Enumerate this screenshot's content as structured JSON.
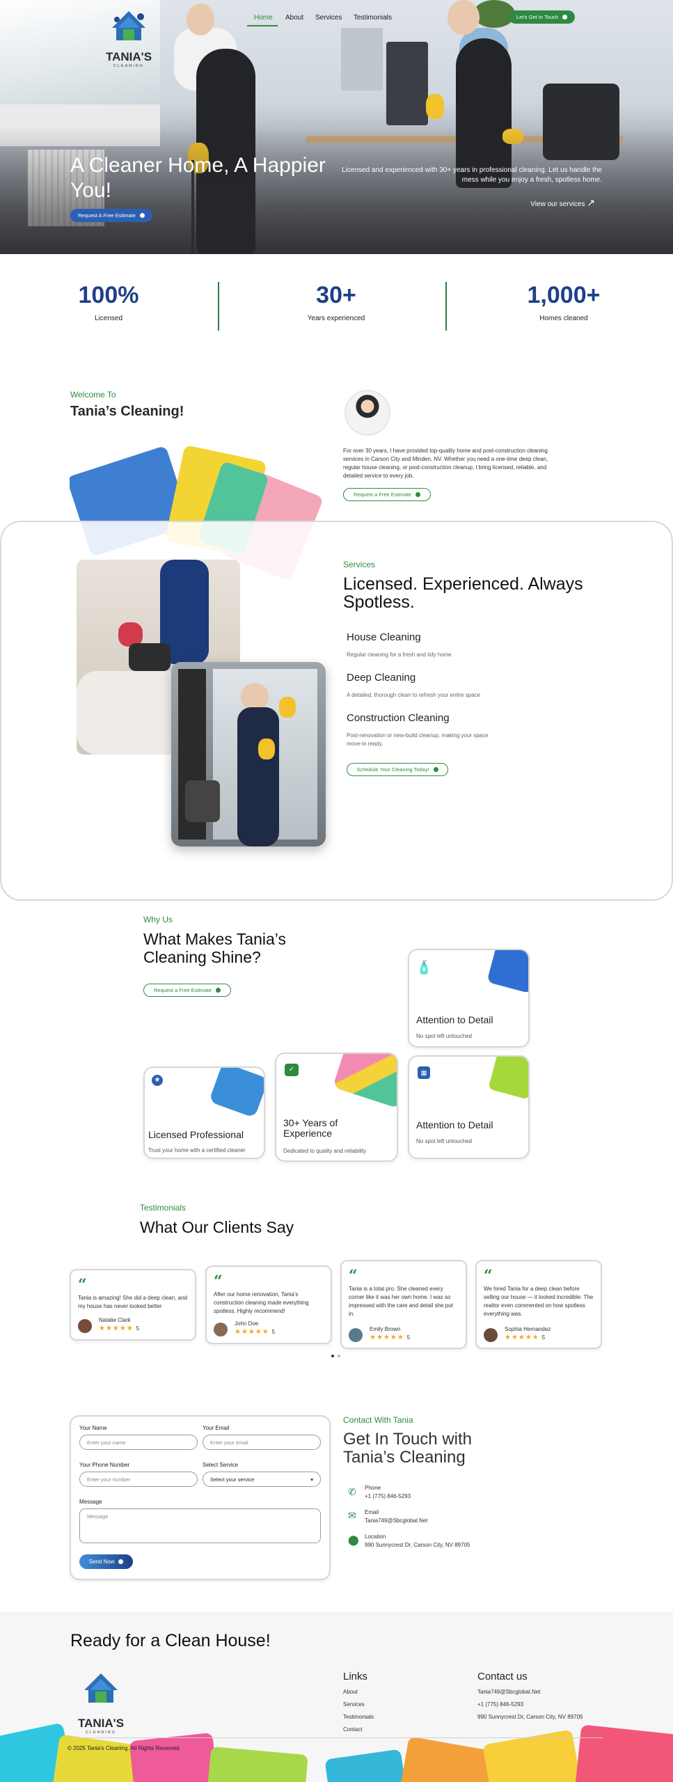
{
  "brand": {
    "name": "TANIA'S",
    "sub": "CLEANING"
  },
  "nav": {
    "items": [
      "Home",
      "About",
      "Services",
      "Testimonials"
    ],
    "cta": "Let's Get In Touch"
  },
  "hero": {
    "title": "A Cleaner Home, A Happier You!",
    "cta": "Request A Free Estimate",
    "blurb": "Licensed and experienced with 30+ years in professional cleaning. Let us handle the mess while you enjoy a fresh, spotless home.",
    "link": "View our services"
  },
  "stats": [
    {
      "num": "100%",
      "label": "Licensed"
    },
    {
      "num": "30+",
      "label": "Years experienced"
    },
    {
      "num": "1,000+",
      "label": "Homes cleaned"
    }
  ],
  "welcome": {
    "eyebrow": "Welcome To",
    "title": "Tania’s Cleaning!",
    "body": "For over 30 years, I have provided top-quality home and post-construction cleaning services in Carson City and Minden, NV. Whether you need a one-time deep clean, regular house cleaning, or post-construction cleanup, I bring licensed, reliable, and detailed service to every job.",
    "cta": "Request a Free Estimate"
  },
  "services": {
    "eyebrow": "Services",
    "title": "Licensed. Experienced. Always Spotless.",
    "items": [
      {
        "name": "House Cleaning",
        "desc": "Regular cleaning for a fresh and tidy home"
      },
      {
        "name": "Deep Cleaning",
        "desc": "A detailed, thorough clean to refresh your entire space"
      },
      {
        "name": "Construction Cleaning",
        "desc": "Post-renovation or new-build cleanup, making your space move-in ready."
      }
    ],
    "cta": "Schedule Your Cleaning Today!"
  },
  "why": {
    "eyebrow": "Why Us",
    "title": "What Makes Tania’s Cleaning Shine?",
    "cta": "Request a Free Estimate",
    "cards": [
      {
        "title": "Attention to Detail",
        "desc": "No spot left untouched",
        "icon": "spray-bottle-icon"
      },
      {
        "title": "Licensed Professional",
        "desc": "Trust your home with a certified cleaner",
        "icon": "badge-icon"
      },
      {
        "title": "30+ Years of Experience",
        "desc": "Dedicated to quality and reliability",
        "icon": "experience-icon"
      },
      {
        "title": "Attention to Detail",
        "desc": "No spot left untouched",
        "icon": "calendar-icon"
      }
    ]
  },
  "testimonials": {
    "eyebrow": "Testimonials",
    "title": "What Our Clients Say",
    "items": [
      {
        "text": "Tania is amazing! She did a deep clean, and my house has never looked better",
        "name": "Natalie Clark",
        "rating": "5"
      },
      {
        "text": "After our home renovation, Tania’s construction cleaning made everything spotless. Highly recommend!",
        "name": "John Doe",
        "rating": "5"
      },
      {
        "text": "Tania is a total pro. She cleaned every corner like it was her own home. I was so impressed with the care and detail she put in.",
        "name": "Emily Brown",
        "rating": "5"
      },
      {
        "text": "We hired Tania for a deep clean before selling our house — it looked incredible. The realtor even commented on how spotless everything was.",
        "name": "Sophia Hernandez",
        "rating": "5"
      }
    ]
  },
  "contact": {
    "eyebrow": "Contact With Tania",
    "title": "Get In Touch with Tania’s Cleaning",
    "form": {
      "name_label": "Your Name",
      "name_ph": "Enter your name",
      "email_label": "Your Email",
      "email_ph": "Enter your email",
      "phone_label": "Your Phone Number",
      "phone_ph": "Enter your number",
      "service_label": "Select Service",
      "service_value": "Select your service",
      "message_label": "Message",
      "message_ph": "Message",
      "submit": "Send Now"
    },
    "phone_label": "Phone",
    "phone": "+1 (775) 846-5293",
    "email_label": "Email",
    "email": "Tania749@Sbcglobal.Net",
    "location_label": "Location",
    "location": "990 Sunnycrest Dr, Carson City, NV 89705"
  },
  "footer": {
    "cta_title": "Ready for a Clean House!",
    "links_title": "Links",
    "links": [
      "About",
      "Services",
      "Testimonials",
      "Contact"
    ],
    "contact_title": "Contact us",
    "email": "Tania749@Sbcglobal.Net",
    "phone": "+1 (775) 846-5293",
    "address": "990 Sunnycrest Dr, Carson City, NV 89705",
    "copyright": "© 2025 Tania's Cleaning. All Rights Reserved"
  },
  "colors": {
    "green": "#2f8a3f",
    "navy": "#1f3f8a",
    "blue": "#2c5fb2"
  }
}
